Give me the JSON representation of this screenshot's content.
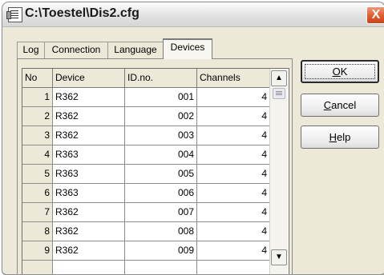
{
  "window": {
    "title": "C:\\Toestel\\Dis2.cfg",
    "close_glyph": "X"
  },
  "tabs": [
    {
      "label": "Log"
    },
    {
      "label": "Connection"
    },
    {
      "label": "Language"
    },
    {
      "label": "Devices",
      "active": true
    }
  ],
  "grid": {
    "columns": [
      "No",
      "Device",
      "ID.no.",
      "Channels"
    ],
    "rows": [
      [
        "1",
        "R362",
        "001",
        "4"
      ],
      [
        "2",
        "R362",
        "002",
        "4"
      ],
      [
        "3",
        "R362",
        "003",
        "4"
      ],
      [
        "4",
        "R363",
        "004",
        "4"
      ],
      [
        "5",
        "R363",
        "005",
        "4"
      ],
      [
        "6",
        "R363",
        "006",
        "4"
      ],
      [
        "7",
        "R362",
        "007",
        "4"
      ],
      [
        "8",
        "R362",
        "008",
        "4"
      ],
      [
        "9",
        "R362",
        "009",
        "4"
      ]
    ]
  },
  "scrollbar": {
    "up_glyph": "▲",
    "down_glyph": "▼"
  },
  "buttons": {
    "ok": {
      "accel": "O",
      "rest": "K"
    },
    "cancel": {
      "accel": "C",
      "rest": "ancel"
    },
    "help": {
      "accel": "H",
      "rest": "elp"
    }
  },
  "icons": {
    "app": "config-file-icon",
    "close": "close-icon",
    "scroll_up": "scroll-up-arrow-icon",
    "scroll_down": "scroll-down-arrow-icon"
  },
  "colors": {
    "dialog_bg": "#ece9d8",
    "close_button": "#e05a2e",
    "grid_bg": "#ffffff",
    "grid_lines": "#8c8c8c"
  }
}
